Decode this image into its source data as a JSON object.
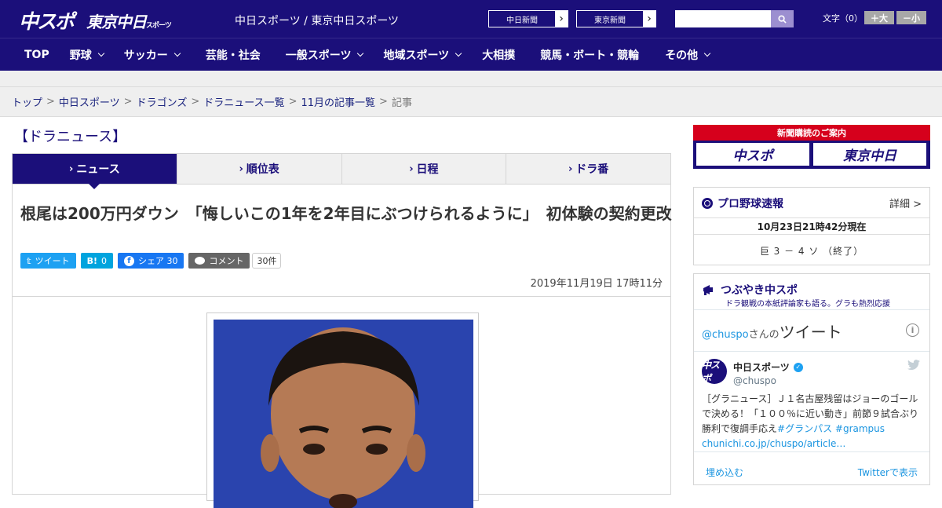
{
  "header": {
    "logo_primary": "中スポ",
    "logo_secondary": "東京中日",
    "logo_secondary_small": "スポーツ",
    "site_name": "中日スポーツ / 東京中日スポーツ",
    "link_chunichi": "中日新聞",
    "link_tokyo": "東京新聞",
    "link_arrow": "›",
    "search_placeholder": "",
    "font_size_label": "文字（0）",
    "font_bigger": "＋大",
    "font_smaller": "－小"
  },
  "nav": {
    "items": [
      {
        "label": "TOP",
        "has_dropdown": false
      },
      {
        "label": "野球",
        "has_dropdown": true
      },
      {
        "label": "サッカー",
        "has_dropdown": true
      },
      {
        "label": "芸能・社会",
        "has_dropdown": false
      },
      {
        "label": "一般スポーツ",
        "has_dropdown": true
      },
      {
        "label": "地域スポーツ",
        "has_dropdown": true
      },
      {
        "label": "大相撲",
        "has_dropdown": false
      },
      {
        "label": "競馬・ボート・競輪",
        "has_dropdown": false
      },
      {
        "label": "その他",
        "has_dropdown": true
      }
    ]
  },
  "breadcrumb": {
    "items": [
      "トップ",
      "中日スポーツ",
      "ドラゴンズ",
      "ドラニュース一覧",
      "11月の記事一覧"
    ],
    "separator": ">",
    "current": "記事"
  },
  "section": {
    "title": "【ドラニュース】"
  },
  "tabs": [
    {
      "label": "ニュース",
      "active": true
    },
    {
      "label": "順位表",
      "active": false
    },
    {
      "label": "日程",
      "active": false
    },
    {
      "label": "ドラ番",
      "active": false
    }
  ],
  "tab_arrow": "›",
  "article": {
    "headline": "根尾は200万円ダウン　「悔しいこの1年を2年目にぶつけられるように」　初体験の契約更改",
    "published": "2019年11月19日 17時11分"
  },
  "social": {
    "tweet_label": "ツイート",
    "tweet_icon": "𝕥",
    "hatena_label": "0",
    "hatena_icon": "B!",
    "share_label": "シェア 30",
    "share_icon": "f",
    "comment_label": "コメント",
    "comment_count": "30件"
  },
  "sidebar": {
    "subscribe": {
      "banner": "新聞購読のご案内",
      "logo_left": "中スポ",
      "logo_right": "東京中日"
    },
    "baseball": {
      "title": "プロ野球速報",
      "detail": "詳細 >",
      "date": "10月23日21時42分現在",
      "score": "巨 3 － 4 ソ （終了）"
    },
    "tsubuyaki": {
      "title": "つぶやき中スポ",
      "subtitle": "ドラ観戦の本紙評論家も語る。グラも熱烈応援",
      "handle_prefix": "@chuspo",
      "handle_suffix": "さんの",
      "tweets_label": "ツイート",
      "info": "i",
      "account_name": "中日スポーツ",
      "account_handle": "@chuspo",
      "avatar_text": "中スポ",
      "tweet_text": "［グラニュース］Ｊ１名古屋残留はジョーのゴールで決める！「１００％に近い動き」前節９試合ぶり勝利で復調手応え",
      "hashtag1": "#グランパス",
      "hashtag2": "#grampus",
      "link": "chunichi.co.jp/chuspo/article…",
      "embed": "埋め込む",
      "view_on_twitter": "Twitterで表示"
    }
  },
  "colors": {
    "brand": "#1b0f7a",
    "twitter": "#1da1f2",
    "hatena": "#00a4de",
    "facebook": "#1877f2",
    "comment": "#666666",
    "subscribe_red": "#d6001c"
  }
}
